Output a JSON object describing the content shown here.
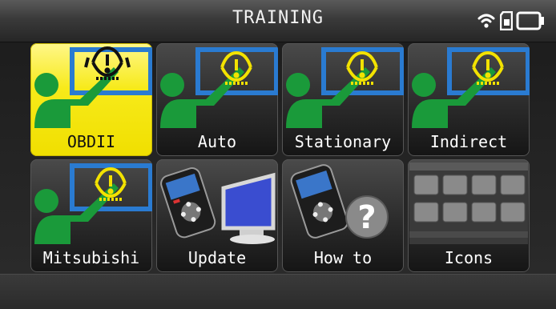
{
  "header": {
    "title": "TRAINING",
    "icons": [
      "wifi-icon",
      "sd-card-icon",
      "battery-icon"
    ]
  },
  "tiles": [
    {
      "label": "OBDII",
      "icon": "tpms-warning-icon",
      "selected": true
    },
    {
      "label": "Auto",
      "icon": "tpms-warning-icon",
      "selected": false
    },
    {
      "label": "Stationary",
      "icon": "tpms-warning-icon",
      "selected": false
    },
    {
      "label": "Indirect",
      "icon": "tpms-warning-icon",
      "selected": false
    },
    {
      "label": "Mitsubishi",
      "icon": "tpms-warning-icon",
      "selected": false
    },
    {
      "label": "Update",
      "icon": "device-computer-icon",
      "selected": false
    },
    {
      "label": "How to",
      "icon": "device-help-icon",
      "selected": false
    },
    {
      "label": "Icons",
      "icon": "icons-menu-preview",
      "selected": false
    }
  ],
  "colors": {
    "selected": "#f7ea1a",
    "green": "#1a9a3a",
    "blue": "#2a7bd1",
    "warning_yellow": "#f3e200"
  }
}
